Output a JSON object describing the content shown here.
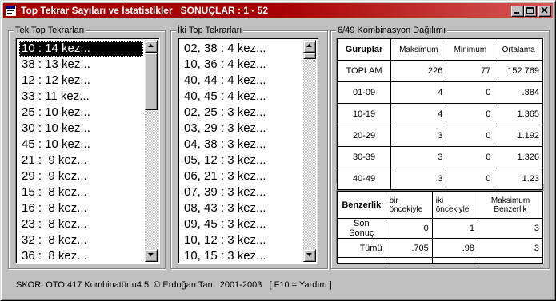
{
  "window": {
    "title": "Top Tekrar Sayıları ve İstatistikler   SONUÇLAR : 1 - 52"
  },
  "single": {
    "label": "Tek Top Tekrarları",
    "items": [
      "10 : 14 kez...",
      "38 : 13 kez...",
      "12 : 12 kez...",
      "33 : 11 kez...",
      "25 : 10 kez...",
      "30 : 10 kez...",
      "45 : 10 kez...",
      "21 :  9 kez...",
      "29 :  9 kez...",
      "15 :  8 kez...",
      "16 :  8 kez...",
      "23 :  8 kez...",
      "32 :  8 kez...",
      "36 :  8 kez..."
    ]
  },
  "double": {
    "label": "İki Top Tekrarları",
    "items": [
      "02, 38 : 4 kez...",
      "10, 36 : 4 kez...",
      "40, 44 : 4 kez...",
      "40, 45 : 4 kez...",
      "02, 25 : 3 kez...",
      "03, 29 : 3 kez...",
      "04, 38 : 3 kez...",
      "05, 12 : 3 kez...",
      "06, 21 : 3 kez...",
      "07, 39 : 3 kez...",
      "08, 43 : 3 kez...",
      "09, 45 : 3 kez...",
      "10, 12 : 3 kez...",
      "10, 15 : 3 kez..."
    ]
  },
  "distribution": {
    "label": "6/49 Kombinasyon Dağılımı",
    "headers": [
      "Guruplar",
      "Maksimum",
      "Minimum",
      "Ortalama"
    ],
    "rows": [
      [
        "TOPLAM",
        "226",
        "77",
        "152.769"
      ],
      [
        "01-09",
        "4",
        "0",
        ".884"
      ],
      [
        "10-19",
        "4",
        "0",
        "1.365"
      ],
      [
        "20-29",
        "3",
        "0",
        "1.192"
      ],
      [
        "30-39",
        "3",
        "0",
        "1.326"
      ],
      [
        "40-49",
        "3",
        "0",
        "1.23"
      ]
    ]
  },
  "similarity": {
    "headers": [
      "Benzerlik",
      "bir öncekiyle",
      "iki öncekiyle",
      "Maksimum Benzerlik"
    ],
    "rows": [
      [
        "Son Sonuç",
        "0",
        "1",
        "3"
      ],
      [
        "Tümü",
        ".705",
        ".98",
        "3"
      ]
    ]
  },
  "status": {
    "text": "SKORLOTO 417 Kombinatör u4.5  © Erdoğan Tan   2001-2003   [ F10 = Yardım ]"
  },
  "colors": {
    "titlebar": "#a80000",
    "face": "#c0c0c0"
  }
}
